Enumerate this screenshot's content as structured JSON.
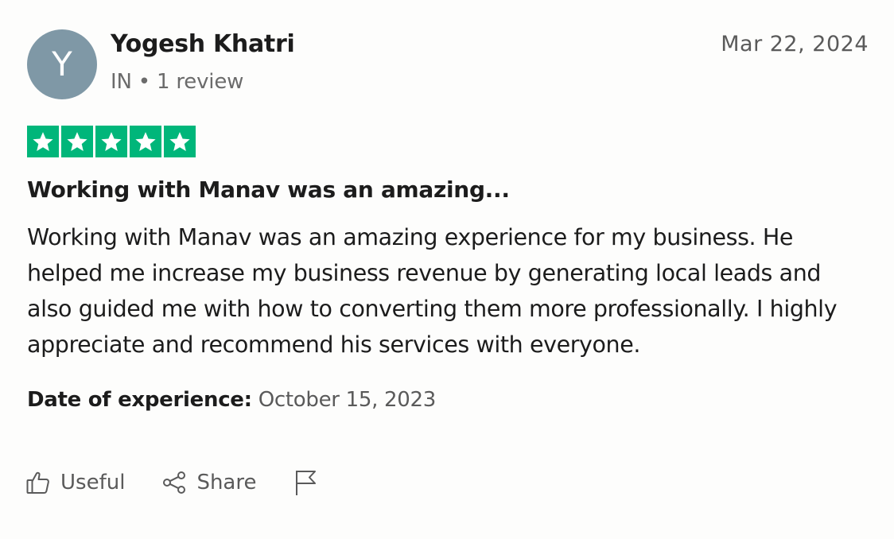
{
  "reviewer": {
    "avatar_letter": "Y",
    "avatar_color": "#7f98a6",
    "name": "Yogesh Khatri",
    "meta": "IN • 1 review"
  },
  "review": {
    "date": "Mar 22, 2024",
    "rating": 5,
    "rating_max": 5,
    "star_color": "#00b67a",
    "title": "Working with Manav was an amazing...",
    "body": "Working with Manav was an amazing experience for my business. He helped me increase my business revenue by generating local leads and also guided me with how to converting them more professionally. I highly appreciate and recommend his services with everyone.",
    "experience_label": "Date of experience:",
    "experience_value": "October 15, 2023"
  },
  "actions": {
    "useful_label": "Useful",
    "useful_icon": "thumbs-up-icon",
    "share_label": "Share",
    "share_icon": "share-icon",
    "report_icon": "flag-icon"
  }
}
